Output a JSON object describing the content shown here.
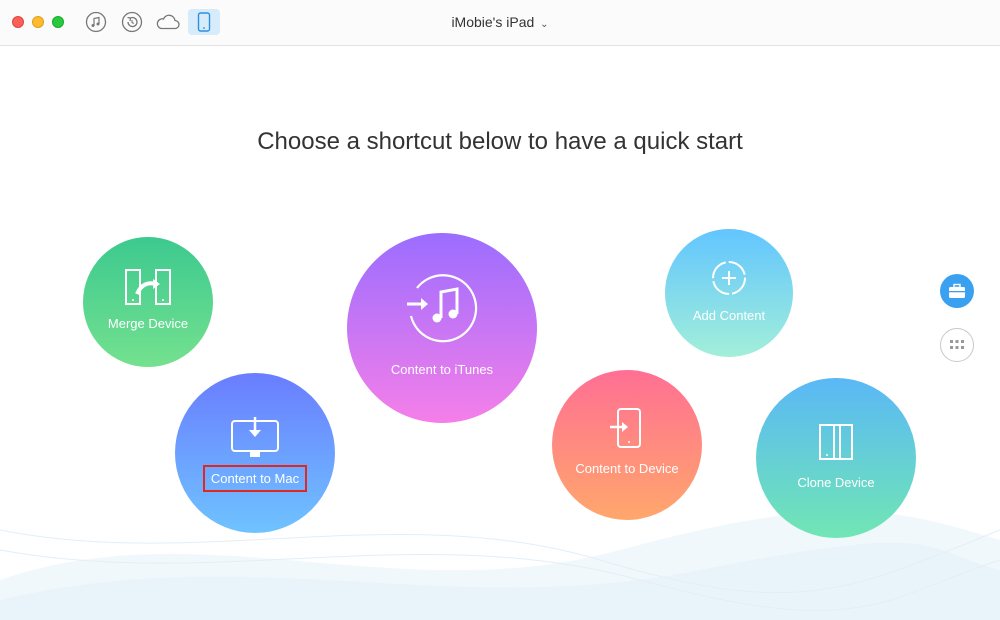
{
  "window": {
    "title": "iMobie's iPad"
  },
  "toolbar": {
    "icons": [
      "music-note-icon",
      "backup-restore-icon",
      "cloud-icon",
      "device-icon"
    ]
  },
  "main": {
    "headline": "Choose a shortcut below to have a quick start"
  },
  "shortcuts": {
    "merge_device": "Merge Device",
    "content_to_mac": "Content to Mac",
    "content_to_itunes": "Content to iTunes",
    "add_content": "Add Content",
    "content_to_device": "Content to Device",
    "clone_device": "Clone Device"
  },
  "colors": {
    "accent": "#3aa0f0",
    "highlight_box": "#e0281f",
    "merge_gradient": [
      "#3cc98f",
      "#74e18f"
    ],
    "mac_gradient": [
      "#6a7dff",
      "#6fc3ff"
    ],
    "itunes_gradient": [
      "#9b6dff",
      "#f57fe9"
    ],
    "add_gradient": [
      "#62c5ff",
      "#a2efd9"
    ],
    "device_gradient": [
      "#ff6f93",
      "#ffa76c"
    ],
    "clone_gradient": [
      "#5ab8f6",
      "#71e6b4"
    ]
  },
  "sidebar": {
    "icons": [
      "toolbox-icon",
      "apps-grid-icon"
    ]
  }
}
